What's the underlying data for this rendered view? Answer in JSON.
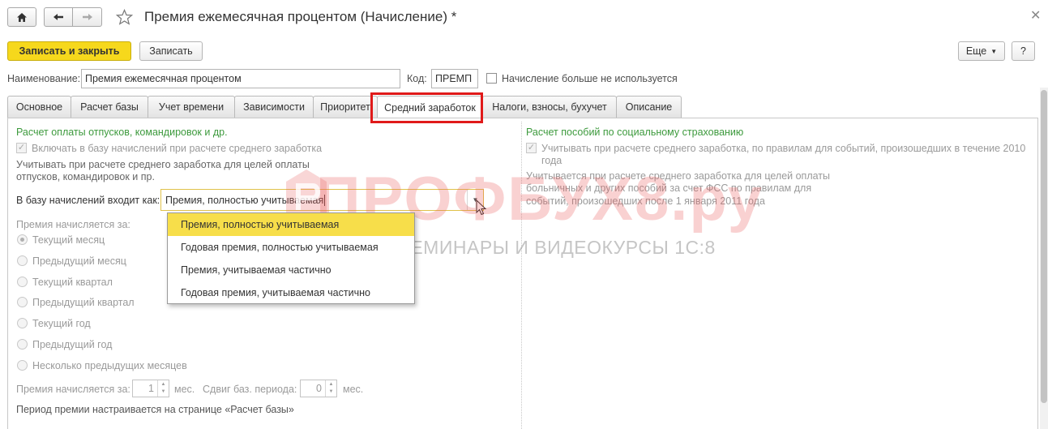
{
  "window": {
    "title": "Премия ежемесячная процентом (Начисление) *"
  },
  "toolbar": {
    "save_close_label": "Записать и закрыть",
    "save_label": "Записать",
    "more_label": "Еще",
    "help_label": "?"
  },
  "form": {
    "name_label": "Наименование:",
    "name_value": "Премия ежемесячная процентом",
    "code_label": "Код:",
    "code_value": "ПРЕМП",
    "not_used_label": "Начисление больше не используется"
  },
  "tabs": [
    {
      "label": "Основное"
    },
    {
      "label": "Расчет базы"
    },
    {
      "label": "Учет времени"
    },
    {
      "label": "Зависимости"
    },
    {
      "label": "Приоритет"
    },
    {
      "label": "Средний заработок"
    },
    {
      "label": "Налоги, взносы, бухучет"
    },
    {
      "label": "Описание"
    }
  ],
  "left": {
    "section_title": "Расчет оплаты отпусков, командировок и др.",
    "include_label": "Включать в базу начислений при расчете среднего заработка",
    "hint_line1": "Учитывать при расчете среднего заработка для целей оплаты",
    "hint_line2": "отпусков, командировок и пр.",
    "base_label": "В базу начислений входит как:",
    "base_value": "Премия, полностью учитываемая",
    "accrued_for_label": "Премия начисляется за:",
    "radios": [
      {
        "label": "Текущий месяц"
      },
      {
        "label": "Предыдущий месяц"
      },
      {
        "label": "Текущий квартал"
      },
      {
        "label": "Предыдущий квартал"
      },
      {
        "label": "Текущий год"
      },
      {
        "label": "Предыдущий год"
      },
      {
        "label": "Несколько предыдущих месяцев"
      }
    ],
    "period_label": "Премия начисляется за:",
    "period_value": "1",
    "period_unit": "мес.",
    "shift_label": "Сдвиг баз. периода:",
    "shift_value": "0",
    "shift_unit": "мес.",
    "footer_note": "Период премии настраивается на странице «Расчет базы»"
  },
  "dropdown": {
    "items": [
      {
        "label": "Премия, полностью учитываемая"
      },
      {
        "label": "Годовая премия, полностью учитываемая"
      },
      {
        "label": "Премия, учитываемая частично"
      },
      {
        "label": "Годовая премия, учитываемая частично"
      }
    ]
  },
  "right": {
    "section_title": "Расчет пособий по социальному страхованию",
    "consider_line1": "Учитывать при расчете среднего заработка, по правилам для событий, произошедших в течение 2010",
    "consider_line2": "года",
    "hint_line1": "Учитывается при расчете среднего заработка для целей оплаты",
    "hint_line2": "больничных и других пособий за счет ФСС по правилам для",
    "hint_line3": "событий, произошедших после 1 января 2011 года"
  },
  "watermark": {
    "brand": "ПРОФБУХ8.ру",
    "tagline": "ОНЛАЙН-СЕМИНАРЫ И ВИДЕОКУРСЫ 1С:8"
  },
  "colors": {
    "accent_yellow": "#f6d81c",
    "green_title": "#3d9a3d",
    "highlight_red": "#e01a1a"
  }
}
